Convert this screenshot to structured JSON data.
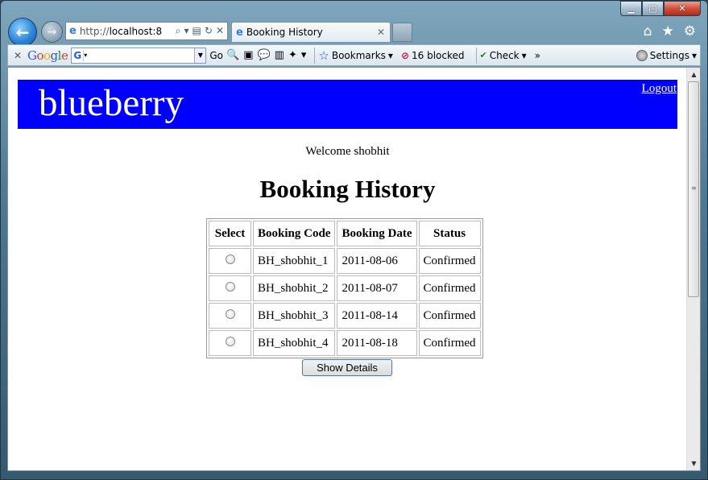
{
  "window": {
    "buttons": {
      "minimize": "▁",
      "maximize": "□",
      "close": "✕"
    }
  },
  "nav": {
    "address_prefix": "http://",
    "address_host": "localhost:8",
    "tab_title": "Booking History",
    "tab_close": "✕"
  },
  "toolbar": {
    "close": "✕",
    "google_letters": [
      "G",
      "o",
      "o",
      "g",
      "l",
      "e"
    ],
    "go_label": "Go",
    "bookmarks_label": "Bookmarks",
    "blocked_label": "16 blocked",
    "check_label": "Check",
    "more_label": "»",
    "settings_label": "Settings"
  },
  "page": {
    "logo": "blueberry",
    "logout": "Logout",
    "welcome": "Welcome shobhit",
    "heading": "Booking History",
    "table": {
      "headers": [
        "Select",
        "Booking Code",
        "Booking Date",
        "Status"
      ],
      "rows": [
        {
          "code": "BH_shobhit_1",
          "date": "2011-08-06",
          "status": "Confirmed"
        },
        {
          "code": "BH_shobhit_2",
          "date": "2011-08-07",
          "status": "Confirmed"
        },
        {
          "code": "BH_shobhit_3",
          "date": "2011-08-14",
          "status": "Confirmed"
        },
        {
          "code": "BH_shobhit_4",
          "date": "2011-08-18",
          "status": "Confirmed"
        }
      ]
    },
    "show_details": "Show Details"
  },
  "colors": {
    "banner": "#0000ff",
    "button_border": "#3b7bbf"
  }
}
